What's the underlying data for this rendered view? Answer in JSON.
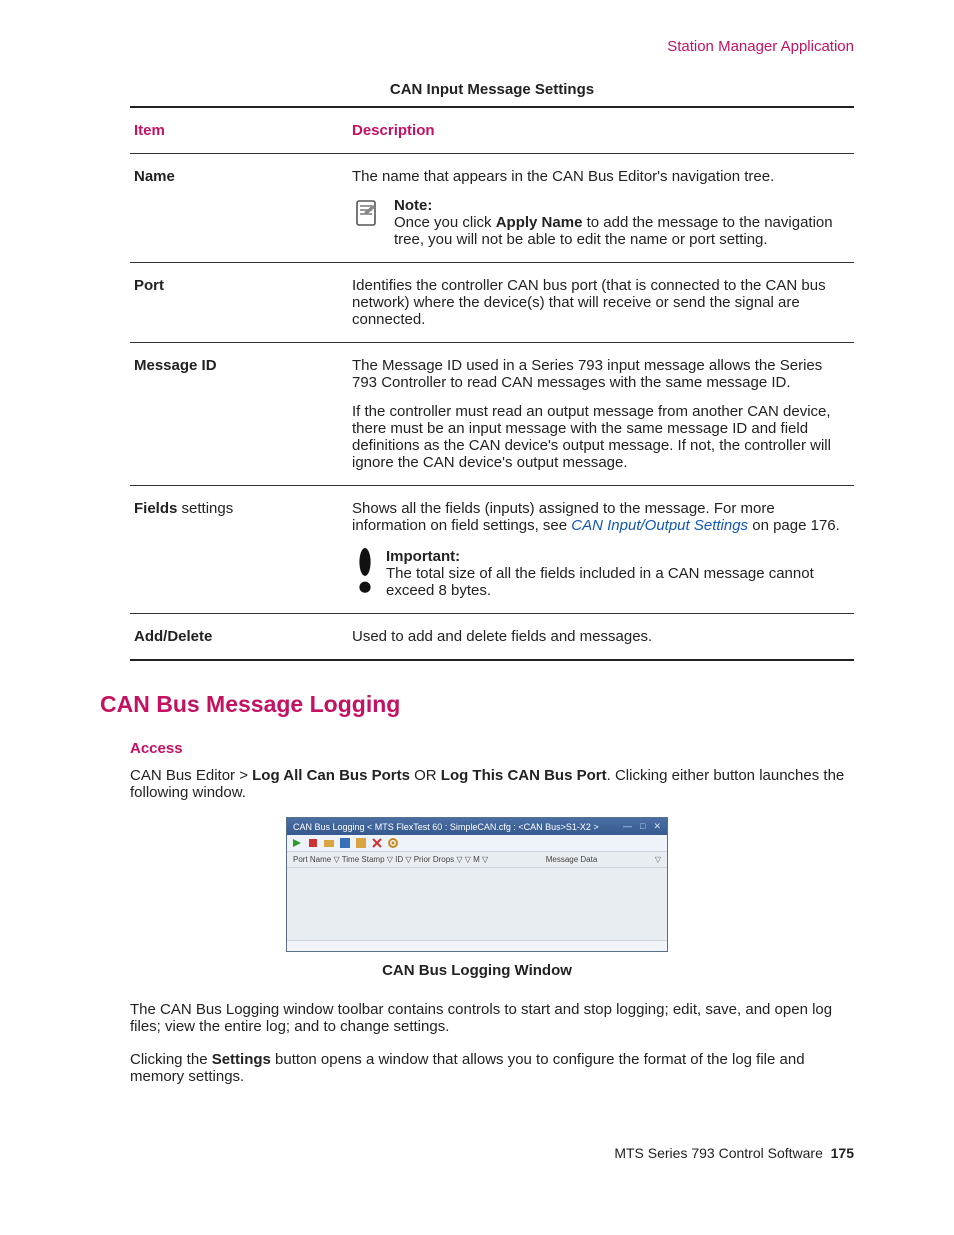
{
  "header": "Station Manager Application",
  "tableTitle": "CAN Input Message Settings",
  "th": {
    "item": "Item",
    "desc": "Description"
  },
  "row": {
    "name": {
      "label": "Name",
      "desc": "The name that appears in the CAN Bus Editor's navigation tree.",
      "noteTitle": "Note:",
      "notePre": "Once you click ",
      "noteBold": "Apply Name",
      "notePost": " to add the message to the navigation tree, you will not be able to edit the name or port setting."
    },
    "port": {
      "label": "Port",
      "desc": "Identifies the controller CAN bus port (that is connected to the CAN bus network) where the device(s) that will receive or send the signal are connected."
    },
    "msg": {
      "label": "Message ID",
      "p1": "The Message ID used in a Series 793 input message allows the Series 793 Controller to read CAN messages with the same message ID.",
      "p2": "If the controller must read an output message from another CAN device, there must be an input message with the same message ID and field definitions as the CAN device's output message. If not, the controller will ignore the CAN device's output message."
    },
    "fields": {
      "label1": "Fields",
      "label2": " settings",
      "descPre": "Shows all the fields (inputs) assigned to the message. For more information on field settings, see ",
      "link": "CAN Input/Output Settings",
      "descPost": " on page 176.",
      "impTitle": "Important:",
      "impText": "The total size of all the fields included in a CAN message cannot exceed 8 bytes."
    },
    "add": {
      "label": "Add/Delete",
      "desc": "Used to add and delete fields and messages."
    }
  },
  "h2": "CAN Bus Message Logging",
  "access": "Access",
  "accessText": {
    "pre": "CAN Bus Editor > ",
    "b1": "Log All Can Bus Ports",
    "mid": " OR ",
    "b2": "Log This CAN Bus Port",
    "post": ". Clicking either button launches the following window."
  },
  "shot": {
    "title": "CAN Bus Logging < MTS FlexTest 60 : SimpleCAN.cfg : <CAN Bus>S1-X2 >",
    "colsLeft": "Port Name  ▽  Time Stamp  ▽  ID ▽  Prior Drops  ▽  ▽   M   ▽",
    "colsRight": "Message Data"
  },
  "caption": "CAN Bus Logging Window",
  "para1": "The CAN Bus Logging window toolbar contains controls to start and stop logging; edit, save, and open log files; view the entire log; and to change settings.",
  "para2": {
    "pre": "Clicking the ",
    "b": "Settings",
    "post": " button opens a window that allows you to configure the format of the log file and memory settings."
  },
  "footer": {
    "product": "MTS Series 793 Control Software",
    "page": "175"
  }
}
